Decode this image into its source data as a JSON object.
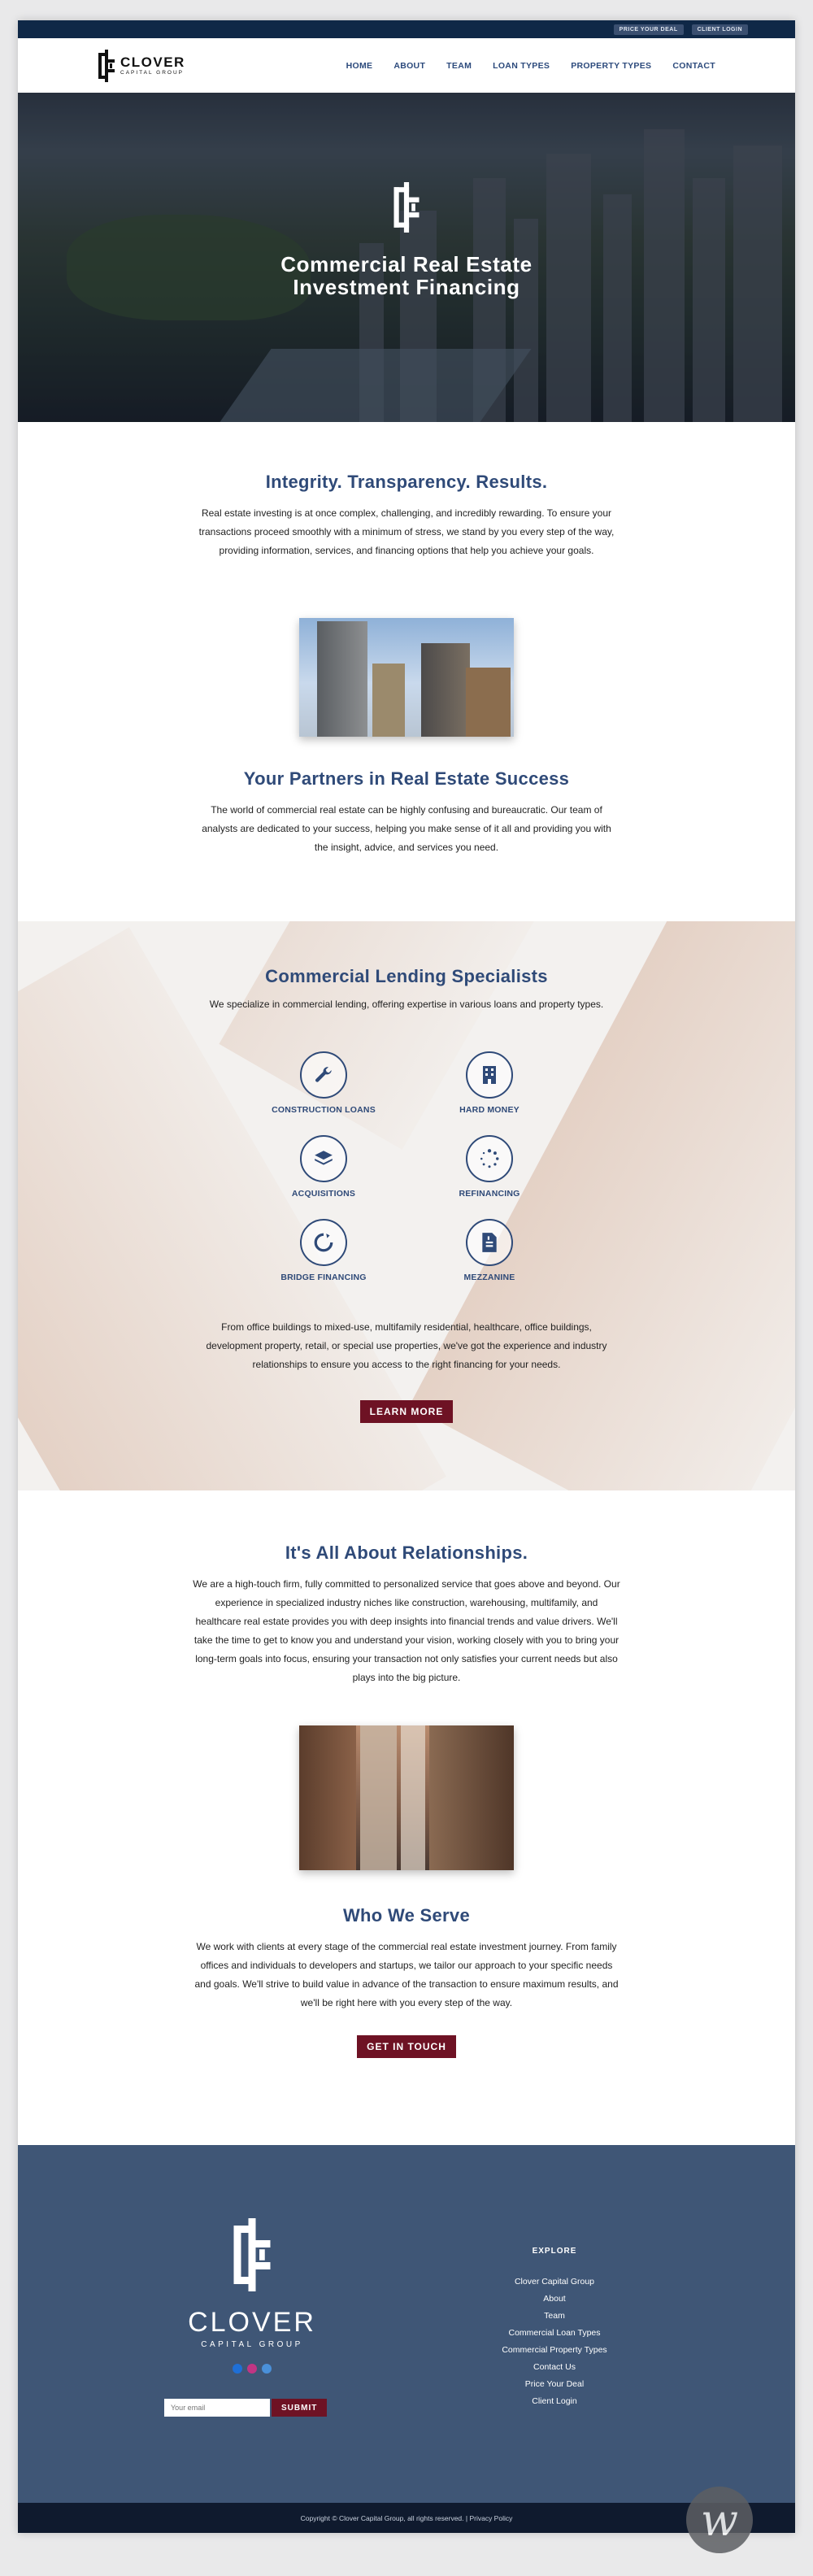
{
  "topbar": {
    "price_deal": "PRICE YOUR DEAL",
    "client_login": "CLIENT LOGIN"
  },
  "brand": {
    "name": "CLOVER",
    "tagline": "CAPITAL GROUP"
  },
  "nav": [
    "HOME",
    "ABOUT",
    "TEAM",
    "LOAN TYPES",
    "PROPERTY TYPES",
    "CONTACT"
  ],
  "hero": {
    "title_line1": "Commercial Real Estate",
    "title_line2": "Investment Financing"
  },
  "intro": {
    "heading": "Integrity. Transparency. Results.",
    "body": "Real estate investing is at once complex, challenging, and incredibly rewarding. To ensure your transactions proceed smoothly with a minimum of stress, we stand by you every step of the way, providing information, services, and financing options that help you achieve your goals."
  },
  "partners": {
    "heading": "Your Partners in Real Estate Success",
    "body": "The world of commercial real estate can be highly confusing and bureaucratic. Our team of analysts are dedicated to your success, helping you make sense of it all and providing you with the insight, advice, and services you need."
  },
  "specialists": {
    "heading": "Commercial Lending Specialists",
    "intro": "We specialize in commercial lending, offering expertise in various loans and property types.",
    "services": [
      {
        "label": "CONSTRUCTION LOANS",
        "icon": "wrench-icon"
      },
      {
        "label": "HARD MONEY",
        "icon": "building-icon"
      },
      {
        "label": "ACQUISITIONS",
        "icon": "layers-icon"
      },
      {
        "label": "REFINANCING",
        "icon": "loading-dots-icon"
      },
      {
        "label": "BRIDGE FINANCING",
        "icon": "circle-arrow-icon"
      },
      {
        "label": "MEZZANINE",
        "icon": "document-icon"
      }
    ],
    "body": "From office buildings to mixed-use, multifamily residential, healthcare, office buildings, development property, retail, or special use properties, we've got the experience and industry relationships to ensure you access to the right financing for your needs.",
    "button": "LEARN MORE"
  },
  "relationships": {
    "heading": "It's All About Relationships.",
    "body": "We are a high-touch firm, fully committed to personalized service that goes above and beyond. Our experience in specialized industry niches like construction, warehousing, multifamily, and healthcare real estate provides you with deep insights into financial trends and value drivers. We'll take the time to get to know you and understand your vision, working closely with you to bring your long-term goals into focus, ensuring your transaction not only satisfies your current needs but also plays into the big picture."
  },
  "serve": {
    "heading": "Who We Serve",
    "body": "We work with clients at every stage of the commercial real estate investment journey. From family offices and individuals to developers and startups, we tailor our approach to your specific needs and goals. We'll strive to build value in advance of the transaction to ensure maximum results, and we'll be right here with you every step of the way.",
    "button": "GET IN TOUCH"
  },
  "footer": {
    "email_placeholder": "Your email",
    "submit": "SUBMIT",
    "explore_heading": "EXPLORE",
    "links": [
      "Clover Capital Group",
      "About",
      "Team",
      "Commercial Loan Types",
      "Commercial Property Types",
      "Contact Us",
      "Price Your Deal",
      "Client Login"
    ],
    "copyright": "Copyright © Clover Capital Group, all rights reserved. | Privacy Policy"
  },
  "colors": {
    "navy": "#0f2847",
    "heading_blue": "#2f4a78",
    "burgundy": "#6e1224",
    "footer_blue": "#3f5676"
  }
}
